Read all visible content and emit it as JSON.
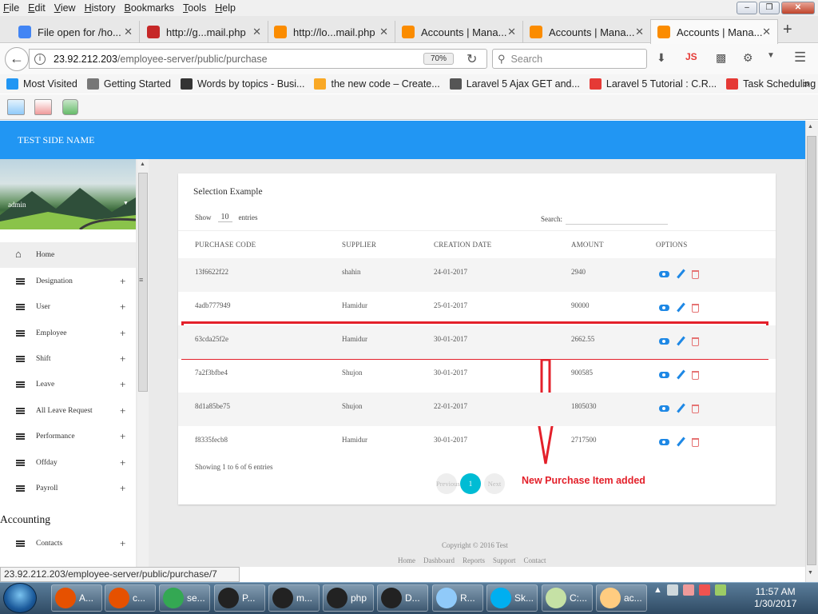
{
  "browser": {
    "menu": [
      "File",
      "Edit",
      "View",
      "History",
      "Bookmarks",
      "Tools",
      "Help"
    ],
    "tabs": [
      {
        "label": "File open for /ho...",
        "icon_color": "#4285f4"
      },
      {
        "label": "http://g...mail.php",
        "icon_color": "#c62828"
      },
      {
        "label": "http://lo...mail.php",
        "icon_color": "#fb8c00"
      },
      {
        "label": "Accounts | Mana...",
        "icon_color": "#fb8c00"
      },
      {
        "label": "Accounts | Mana...",
        "icon_color": "#fb8c00"
      },
      {
        "label": "Accounts | Mana...",
        "icon_color": "#fb8c00"
      }
    ],
    "url_prefix": "23.92.212.203",
    "url_path": "/employee-server/public/purchase",
    "zoom": "70%",
    "search_placeholder": "Search",
    "bookmarks": [
      {
        "label": "Most Visited",
        "color": "#2196f3"
      },
      {
        "label": "Getting Started",
        "color": "#777"
      },
      {
        "label": "Words by topics - Busi...",
        "color": "#333"
      },
      {
        "label": "the new code – Create...",
        "color": "#f9a825"
      },
      {
        "label": "Laravel 5 Ajax GET and...",
        "color": "#555"
      },
      {
        "label": "Laravel 5 Tutorial : C.R...",
        "color": "#e53935"
      },
      {
        "label": "Task Scheduling - Lar...",
        "color": "#e53935"
      }
    ],
    "status_url": "23.92.212.203/employee-server/public/purchase/7"
  },
  "app": {
    "site_name": "TEST SIDE NAME",
    "user": "admin",
    "nav": [
      {
        "label": "Home",
        "active": true,
        "expand": ""
      },
      {
        "label": "Designation",
        "expand": "+"
      },
      {
        "label": "User",
        "expand": "+"
      },
      {
        "label": "Employee",
        "expand": "+"
      },
      {
        "label": "Shift",
        "expand": "+"
      },
      {
        "label": "Leave",
        "expand": "+"
      },
      {
        "label": "All Leave Request",
        "expand": "+"
      },
      {
        "label": "Performance",
        "expand": "+"
      },
      {
        "label": "Offday",
        "expand": "+"
      },
      {
        "label": "Payroll",
        "expand": "+"
      }
    ],
    "section_accounting": "Accounting",
    "nav_accounting": [
      {
        "label": "Contacts",
        "expand": "+"
      }
    ],
    "card_title": "Selection Example",
    "show_label": "Show",
    "show_value": "10",
    "entries_label": "entries",
    "search_label": "Search:",
    "columns": [
      "PURCHASE CODE",
      "SUPPLIER",
      "CREATION DATE",
      "AMOUNT",
      "OPTIONS"
    ],
    "rows": [
      [
        "13f6622f22",
        "shahin",
        "24-01-2017",
        "2940"
      ],
      [
        "4adb777949",
        "Hamidur",
        "25-01-2017",
        "90000"
      ],
      [
        "63cda25f2e",
        "Hamidur",
        "30-01-2017",
        "2662.55"
      ],
      [
        "7a2f3bfbe4",
        "Shujon",
        "30-01-2017",
        "900585"
      ],
      [
        "8d1a85be75",
        "Shujon",
        "22-01-2017",
        "1805030"
      ],
      [
        "f8335fecb8",
        "Hamidur",
        "30-01-2017",
        "2717500"
      ]
    ],
    "highlighted_row": 2,
    "showing": "Showing 1 to 6 of 6 entries",
    "pager": {
      "prev": "Previous",
      "current": "1",
      "next": "Next"
    },
    "annotation": "New Purchase Item added",
    "copyright": "Copyright © 2016 Test",
    "footer_links": [
      "Home",
      "Dashboard",
      "Reports",
      "Support",
      "Contact"
    ]
  },
  "taskbar": {
    "items": [
      {
        "label": "A...",
        "color": "#e65100"
      },
      {
        "label": "c...",
        "color": "#e65100"
      },
      {
        "label": "se...",
        "color": "#34a853"
      },
      {
        "label": "P...",
        "color": "#222"
      },
      {
        "label": "m...",
        "color": "#222"
      },
      {
        "label": "php",
        "color": "#222"
      },
      {
        "label": "D...",
        "color": "#222"
      },
      {
        "label": "R...",
        "color": "#90caf9"
      },
      {
        "label": "Sk...",
        "color": "#00aff0"
      },
      {
        "label": "C:...",
        "color": "#c5e1a5"
      },
      {
        "label": "ac...",
        "color": "#ffcc80"
      }
    ],
    "time": "11:57 AM",
    "date": "1/30/2017"
  }
}
